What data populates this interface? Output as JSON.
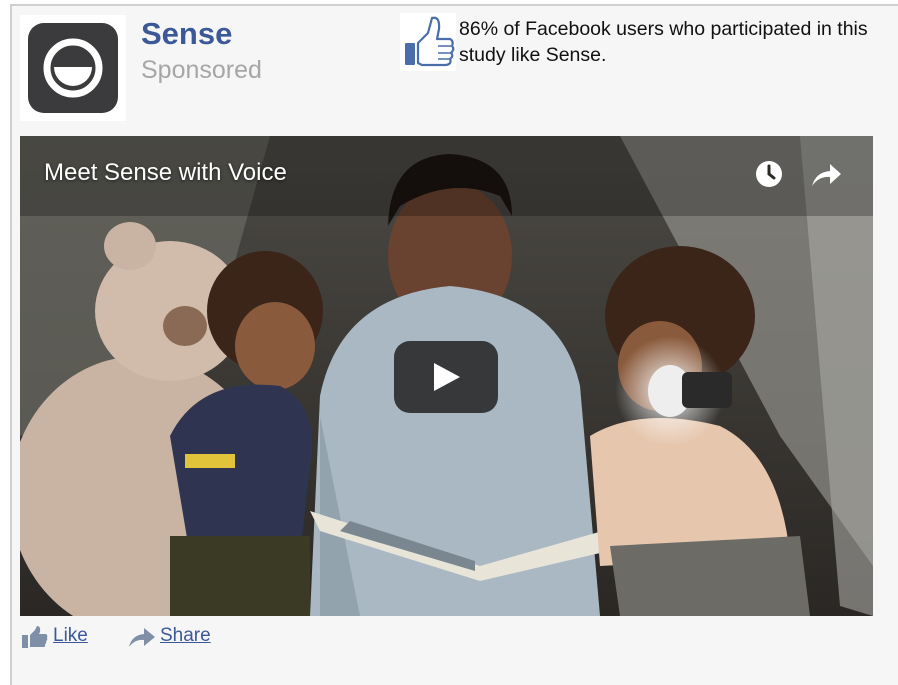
{
  "ad": {
    "brand_name": "Sense",
    "sponsored_label": "Sponsored",
    "logo_icon": "sense-logo-icon",
    "like_stat": {
      "icon": "thumbs-up-icon",
      "text": "86% of Facebook users who participated in this study like Sense."
    }
  },
  "video": {
    "title": "Meet Sense with Voice",
    "controls": {
      "watch_later_icon": "clock-icon",
      "share_icon": "share-arrow-icon",
      "play_icon": "play-icon"
    }
  },
  "actions": {
    "like_label": "Like",
    "share_label": "Share"
  },
  "colors": {
    "brand_blue": "#3b5998",
    "muted_gray": "#a6a6a6",
    "card_background": "#f6f6f6"
  }
}
